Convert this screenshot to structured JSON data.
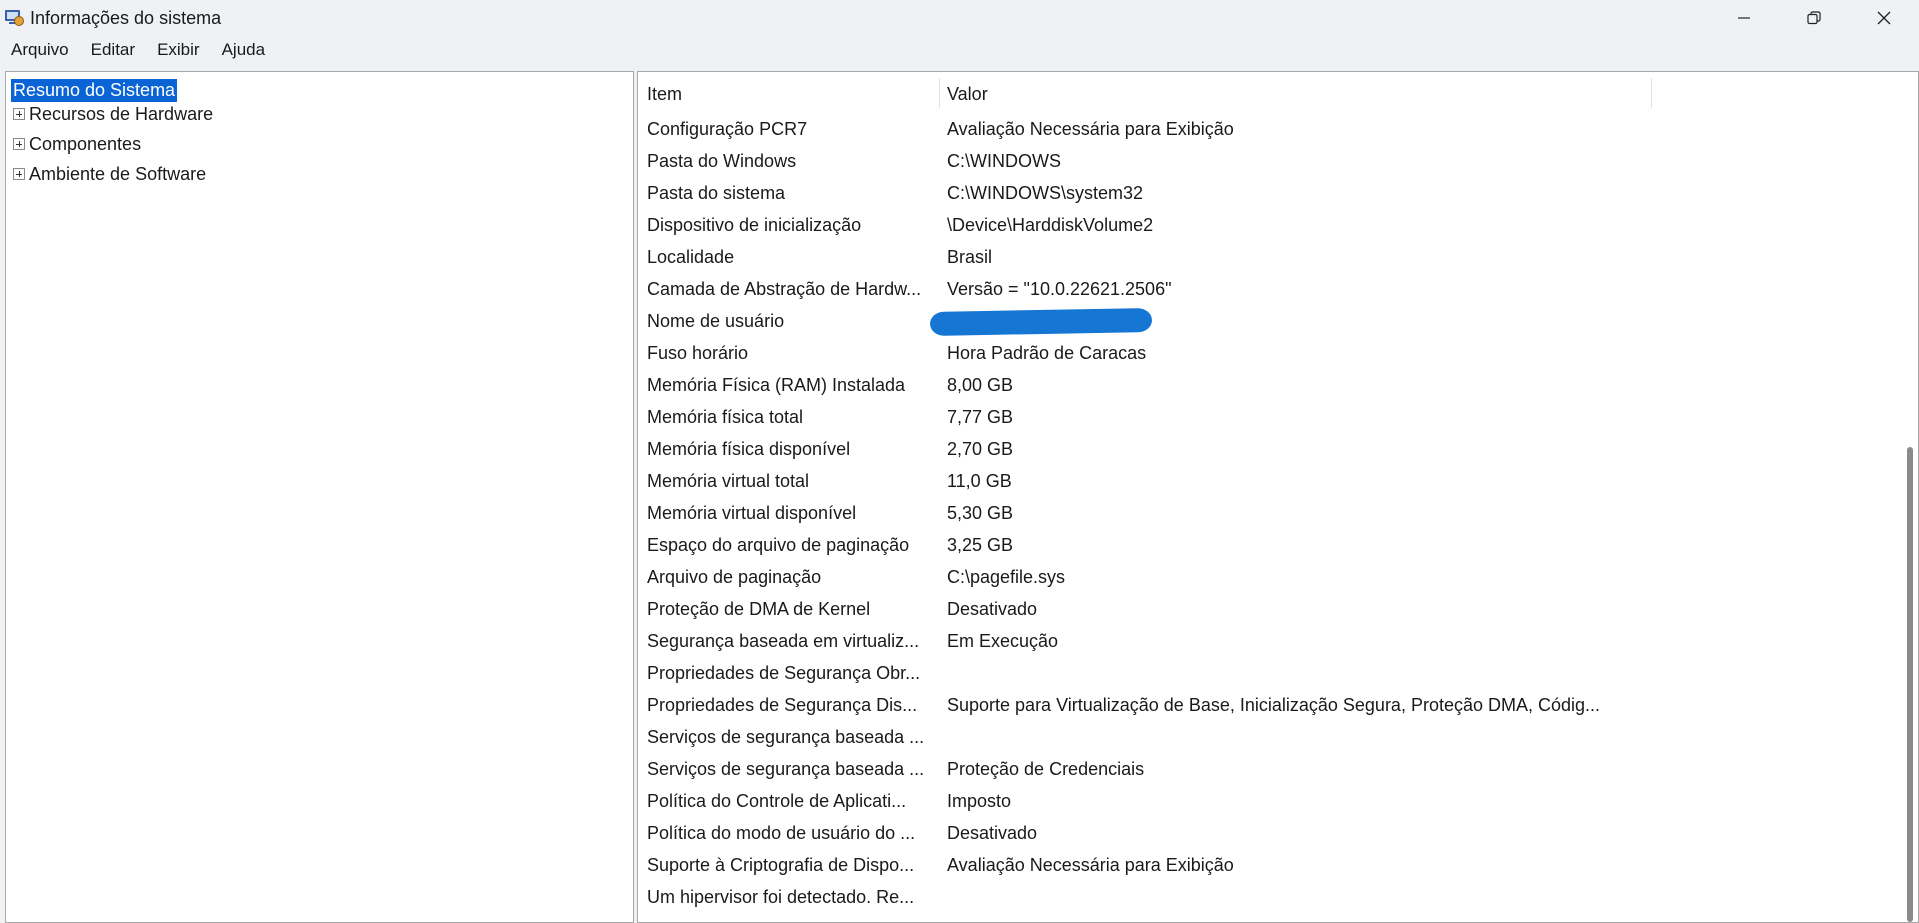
{
  "window": {
    "title": "Informações do sistema",
    "icon": "system-information-icon"
  },
  "window_controls": {
    "minimize": "minimize-icon",
    "restore": "restore-icon",
    "close": "close-icon"
  },
  "menu": {
    "items": [
      "Arquivo",
      "Editar",
      "Exibir",
      "Ajuda"
    ]
  },
  "tree": {
    "selected": "Resumo do Sistema",
    "nodes": [
      "Recursos de Hardware",
      "Componentes",
      "Ambiente de Software"
    ]
  },
  "table": {
    "columns": [
      "Item",
      "Valor"
    ],
    "rows": [
      {
        "item": "Configuração PCR7",
        "value": "Avaliação Necessária para Exibição"
      },
      {
        "item": "Pasta do Windows",
        "value": "C:\\WINDOWS"
      },
      {
        "item": "Pasta do sistema",
        "value": "C:\\WINDOWS\\system32"
      },
      {
        "item": "Dispositivo de inicialização",
        "value": "\\Device\\HarddiskVolume2"
      },
      {
        "item": "Localidade",
        "value": "Brasil"
      },
      {
        "item": "Camada de Abstração de Hardw...",
        "value": "Versão = \"10.0.22621.2506\""
      },
      {
        "item": "Nome de usuário",
        "value": "",
        "redacted": true
      },
      {
        "item": "Fuso horário",
        "value": "Hora Padrão de Caracas"
      },
      {
        "item": "Memória Física (RAM) Instalada",
        "value": "8,00 GB"
      },
      {
        "item": "Memória física total",
        "value": "7,77 GB"
      },
      {
        "item": "Memória física disponível",
        "value": "2,70 GB"
      },
      {
        "item": "Memória virtual total",
        "value": "11,0 GB"
      },
      {
        "item": "Memória virtual disponível",
        "value": "5,30 GB"
      },
      {
        "item": "Espaço do arquivo de paginação",
        "value": "3,25 GB"
      },
      {
        "item": "Arquivo de paginação",
        "value": "C:\\pagefile.sys"
      },
      {
        "item": "Proteção de DMA de Kernel",
        "value": "Desativado"
      },
      {
        "item": "Segurança baseada em virtualiz...",
        "value": "Em Execução"
      },
      {
        "item": "Propriedades de Segurança Obr...",
        "value": ""
      },
      {
        "item": "Propriedades de Segurança Dis...",
        "value": "Suporte para Virtualização de Base, Inicialização Segura, Proteção DMA, Códig..."
      },
      {
        "item": "Serviços de segurança baseada ...",
        "value": ""
      },
      {
        "item": "Serviços de segurança baseada ...",
        "value": "Proteção de Credenciais"
      },
      {
        "item": "Política do Controle de Aplicati...",
        "value": "Imposto"
      },
      {
        "item": "Política do modo de usuário do ...",
        "value": "Desativado"
      },
      {
        "item": "Suporte à Criptografia de Dispo...",
        "value": "Avaliação Necessária para Exibição"
      },
      {
        "item": "Um hipervisor foi detectado. Re...",
        "value": ""
      }
    ]
  },
  "scrollbar": {
    "position_fraction": 0.44
  }
}
